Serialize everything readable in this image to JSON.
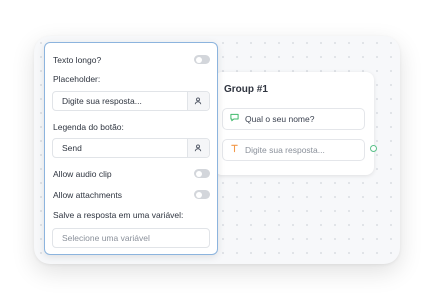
{
  "group": {
    "title": "Group #1",
    "blocks": [
      {
        "icon": "chat-bubble-icon",
        "color": "#3fb96a",
        "text": "Qual o seu nome?"
      },
      {
        "icon": "text-cursor-icon",
        "color": "#f2994a",
        "text": "Digite sua resposta..."
      }
    ]
  },
  "settings": {
    "long_text": {
      "label": "Texto longo?",
      "enabled": false
    },
    "placeholder": {
      "label": "Placeholder:",
      "value": "Digite sua resposta..."
    },
    "button_label": {
      "label": "Legenda do botão:",
      "value": "Send"
    },
    "audio_clip": {
      "label": "Allow audio clip",
      "enabled": false
    },
    "attachments": {
      "label": "Allow attachments",
      "enabled": false
    },
    "save_variable": {
      "label": "Salve a resposta em uma variável:",
      "placeholder": "Selecione uma variável"
    }
  },
  "colors": {
    "panel_border": "#8cb4de",
    "connector": "#59c089"
  }
}
